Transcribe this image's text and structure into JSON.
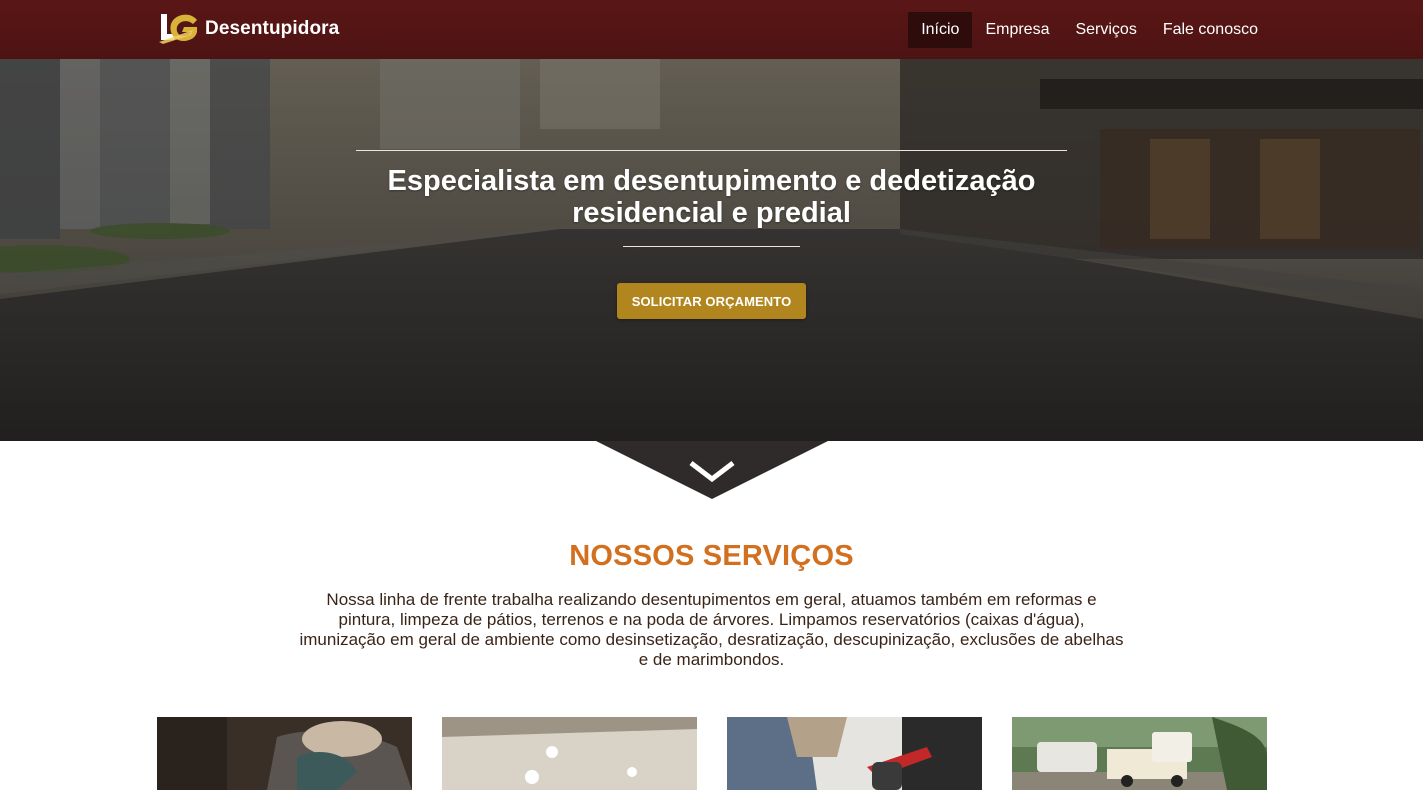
{
  "brand": {
    "logo_icon": "lg-monogram-logo",
    "name": "Desentupidora",
    "colors": {
      "gold": "#d9b23a",
      "white": "#ffffff"
    }
  },
  "nav": {
    "items": [
      {
        "label": "Início",
        "active": true
      },
      {
        "label": "Empresa",
        "active": false
      },
      {
        "label": "Serviços",
        "active": false
      },
      {
        "label": "Fale conosco",
        "active": false
      }
    ]
  },
  "hero": {
    "title": "Especialista em desentupimento e dedetização residencial e predial",
    "cta_label": "SOLICITAR ORÇAMENTO",
    "scroll_icon": "chevron-down-icon"
  },
  "services": {
    "title": "NOSSOS SERVIÇOS",
    "description": "Nossa linha de frente trabalha realizando desentupimentos em geral, atuamos também em reformas e pintura, limpeza de pátios, terrenos e na poda de árvores. Limpamos reservatórios (caixas d'água), imunização em geral de ambiente como desinsetização, desratização, descupinização, exclusões de abelhas e de marimbondos.",
    "cards": [
      {
        "image": "drain-cleaning-photo"
      },
      {
        "image": "ceiling-lights-photo"
      },
      {
        "image": "pest-control-sprayer-photo"
      },
      {
        "image": "service-truck-photo"
      }
    ]
  },
  "colors": {
    "navbar": "#5a1616",
    "active_nav": "#2e0c0c",
    "cta": "#b2861f",
    "section_title": "#d2701f",
    "body_text": "#3a2418",
    "arrow_tab": "#2f2b2a"
  }
}
